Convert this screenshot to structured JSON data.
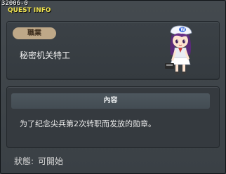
{
  "window": {
    "quest_id": "32006-0",
    "title": "QUEST INFO"
  },
  "job": {
    "label": "職業",
    "value": "秘密机关特工"
  },
  "content": {
    "header": "內容",
    "text": "为了纪念尖兵第2次转职而发放的勋章。"
  },
  "status": {
    "label": "狀態:",
    "value": "可開始"
  },
  "colors": {
    "title_yellow": "#f3e651",
    "badge_tan": "#bea888",
    "panel_dark": "#353a3f",
    "window_bg": "#3b4146"
  },
  "icons": {
    "npc": "npc-character-icon"
  }
}
